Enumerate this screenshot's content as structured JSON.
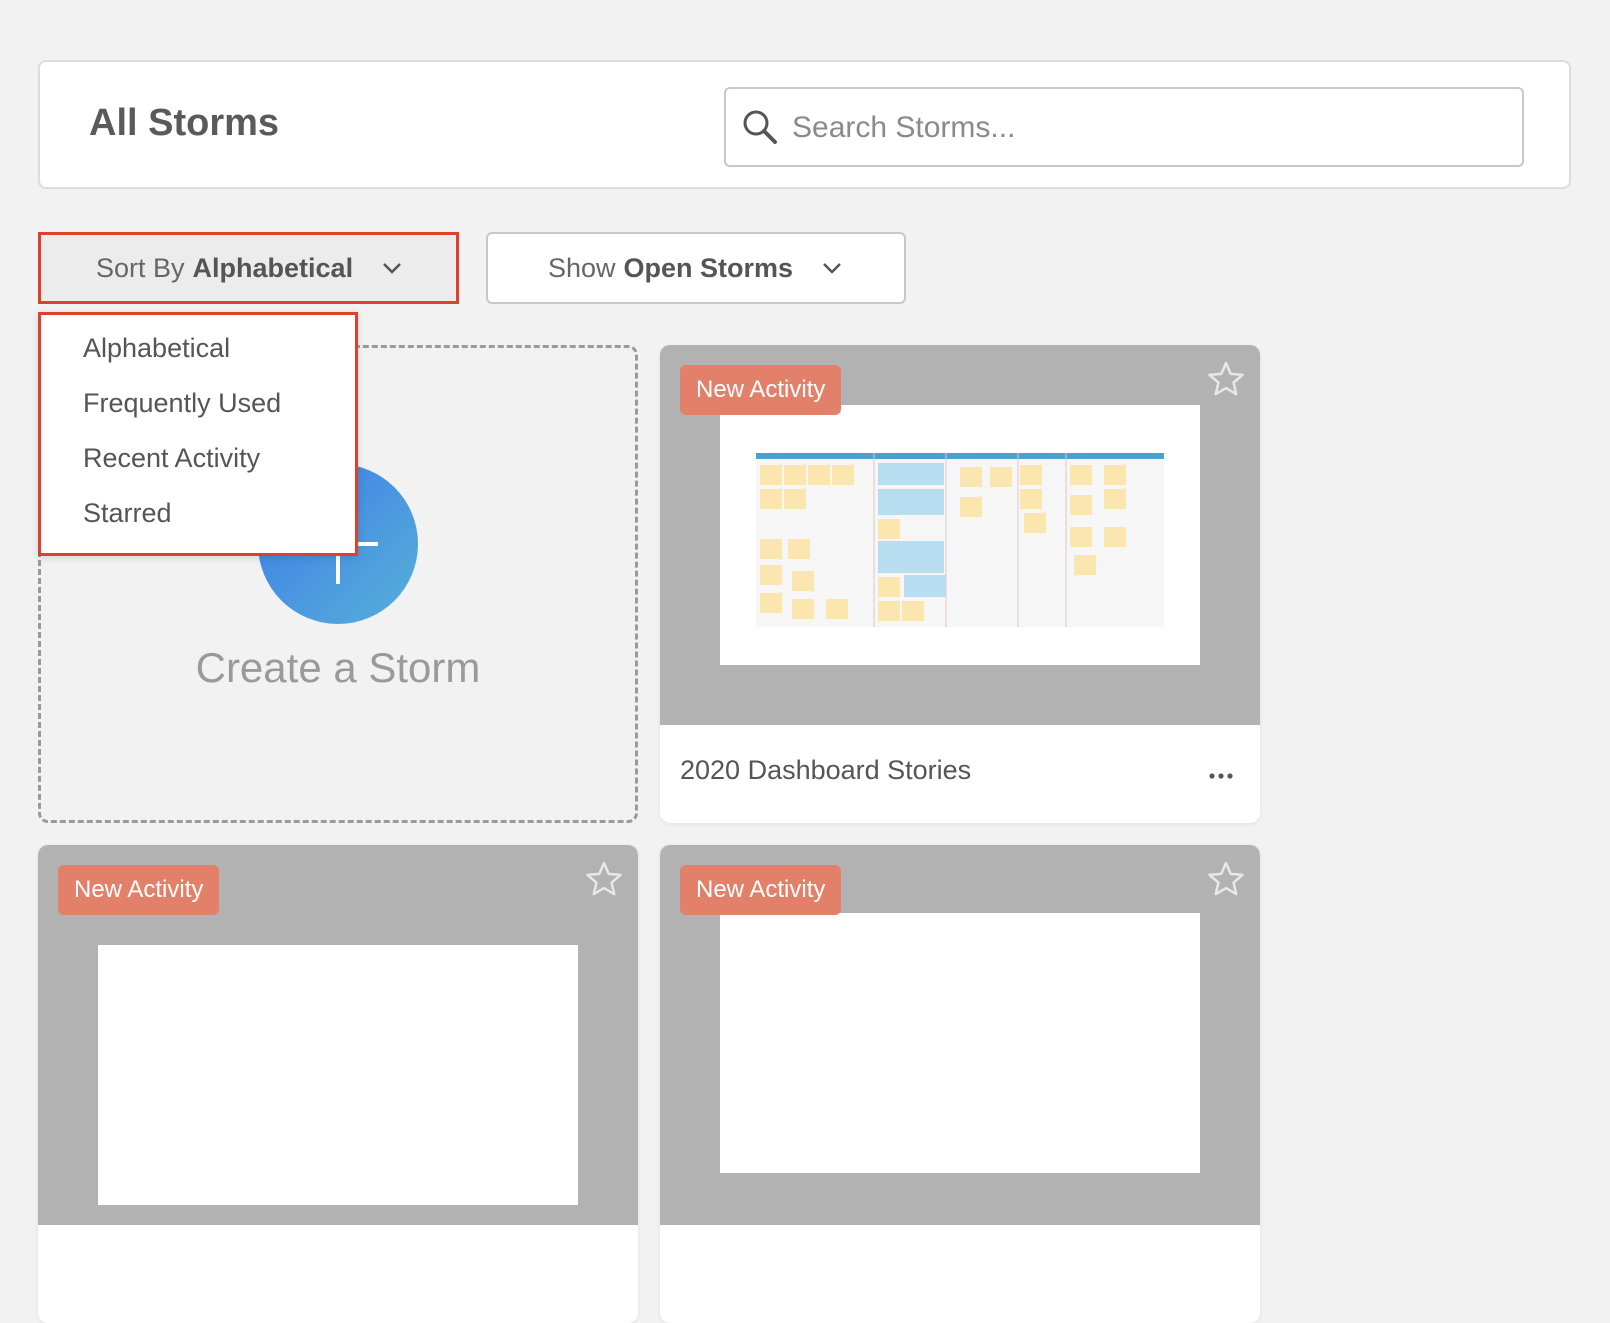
{
  "header": {
    "title": "All Storms",
    "search_placeholder": "Search Storms..."
  },
  "sort": {
    "prefix": "Sort By",
    "value": "Alphabetical",
    "options": [
      "Alphabetical",
      "Frequently Used",
      "Recent Activity",
      "Starred"
    ]
  },
  "filter": {
    "prefix": "Show",
    "value": "Open Storms"
  },
  "create_card": {
    "label": "Create a Storm"
  },
  "cards": [
    {
      "badge": "New Activity",
      "title": "2020 Dashboard Stories"
    },
    {
      "badge": "New Activity",
      "title": ""
    },
    {
      "badge": "New Activity",
      "title": ""
    }
  ],
  "colors": {
    "background": "#f2f2f2",
    "highlight": "#e0402a",
    "badge": "#e2806a",
    "card_thumb_bg": "#b2b2b2",
    "create_gradient_start": "#3b7be8",
    "create_gradient_end": "#58b0d8"
  },
  "icons": [
    "search-icon",
    "chevron-down-icon",
    "star-icon",
    "more-icon",
    "plus-icon"
  ]
}
